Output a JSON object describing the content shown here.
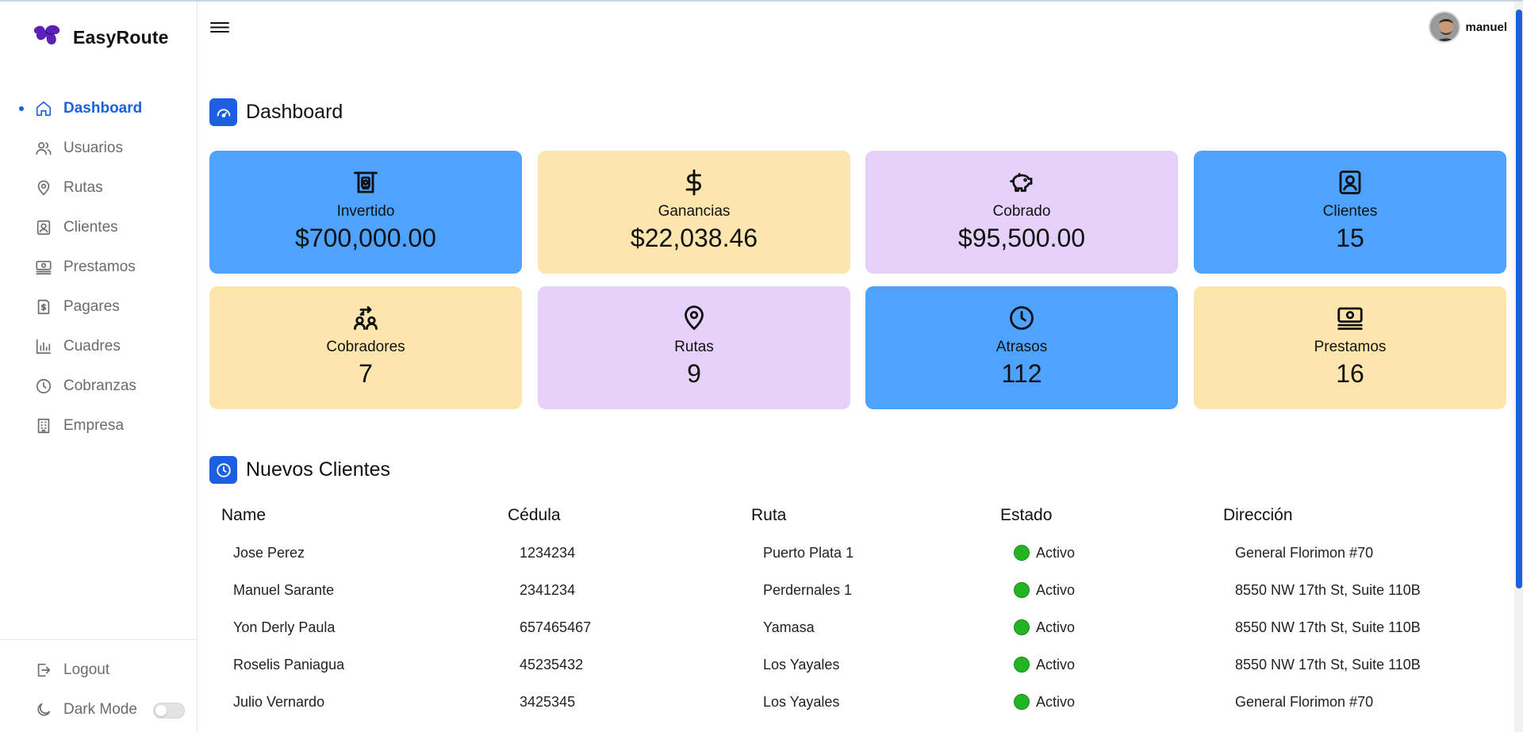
{
  "brand": {
    "name": "EasyRoute",
    "logo_icon": "ribbon-logo",
    "logo_color": "#5b21b6"
  },
  "sidebar": {
    "items": [
      {
        "label": "Dashboard",
        "icon": "home-icon",
        "active": true
      },
      {
        "label": "Usuarios",
        "icon": "users-icon"
      },
      {
        "label": "Rutas",
        "icon": "map-pin-icon"
      },
      {
        "label": "Clientes",
        "icon": "contact-icon"
      },
      {
        "label": "Prestamos",
        "icon": "banknote-icon"
      },
      {
        "label": "Pagares",
        "icon": "receipt-icon"
      },
      {
        "label": "Cuadres",
        "icon": "bar-chart-icon"
      },
      {
        "label": "Cobranzas",
        "icon": "clock-icon"
      },
      {
        "label": "Empresa",
        "icon": "building-icon"
      }
    ],
    "logout_label": "Logout",
    "dark_mode_label": "Dark Mode",
    "dark_mode_on": false
  },
  "header": {
    "username": "manuel"
  },
  "dashboard": {
    "title": "Dashboard",
    "cards": [
      {
        "label": "Invertido",
        "value": "$700,000.00",
        "icon": "atm-icon",
        "color": "#4da3ff"
      },
      {
        "label": "Ganancias",
        "value": "$22,038.46",
        "icon": "dollar-icon",
        "color": "#fde6ad"
      },
      {
        "label": "Cobrado",
        "value": "$95,500.00",
        "icon": "piggy-bank-icon",
        "color": "#e5d1fa"
      },
      {
        "label": "Clientes",
        "value": "15",
        "icon": "contact-icon",
        "color": "#4da3ff"
      },
      {
        "label": "Cobradores",
        "value": "7",
        "icon": "exchange-users-icon",
        "color": "#fde6ad"
      },
      {
        "label": "Rutas",
        "value": "9",
        "icon": "map-pin-icon",
        "color": "#e5d1fa"
      },
      {
        "label": "Atrasos",
        "value": "112",
        "icon": "clock-icon",
        "color": "#4da3ff"
      },
      {
        "label": "Prestamos",
        "value": "16",
        "icon": "banknote-icon",
        "color": "#fde6ad"
      }
    ]
  },
  "clients": {
    "title": "Nuevos Clientes",
    "headers": [
      "Name",
      "Cédula",
      "Ruta",
      "Estado",
      "Dirección"
    ],
    "rows": [
      {
        "name": "Jose Perez",
        "cedula": "1234234",
        "ruta": "Puerto Plata 1",
        "estado": "Activo",
        "direccion": "General Florimon #70"
      },
      {
        "name": "Manuel Sarante",
        "cedula": "2341234",
        "ruta": "Perdernales 1",
        "estado": "Activo",
        "direccion": "8550 NW 17th St, Suite 110B"
      },
      {
        "name": "Yon Derly Paula",
        "cedula": "657465467",
        "ruta": "Yamasa",
        "estado": "Activo",
        "direccion": "8550 NW 17th St, Suite 110B"
      },
      {
        "name": "Roselis Paniagua",
        "cedula": "45235432",
        "ruta": "Los Yayales",
        "estado": "Activo",
        "direccion": "8550 NW 17th St, Suite 110B"
      },
      {
        "name": "Julio Vernardo",
        "cedula": "3425345",
        "ruta": "Los Yayales",
        "estado": "Activo",
        "direccion": "General Florimon #70"
      }
    ],
    "status_color": "#22b422"
  },
  "accent": "#1c5fe0"
}
